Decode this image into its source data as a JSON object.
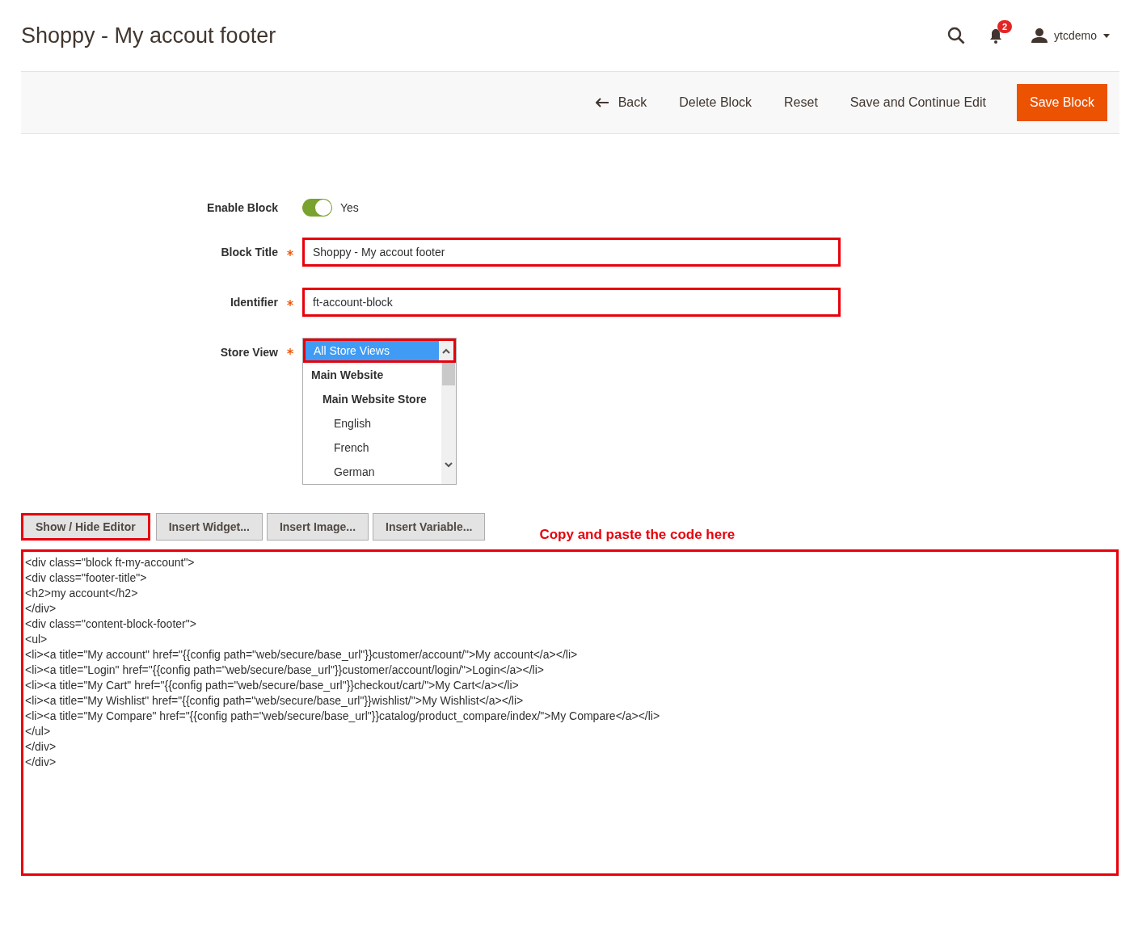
{
  "header": {
    "title": "Shoppy - My accout footer",
    "notifications": "2",
    "user": "ytcdemo"
  },
  "actions": [
    {
      "kind": "back",
      "label": "Back"
    },
    {
      "kind": "plain",
      "label": "Delete Block"
    },
    {
      "kind": "plain",
      "label": "Reset"
    },
    {
      "kind": "plain",
      "label": "Save and Continue Edit"
    },
    {
      "kind": "primary",
      "label": "Save Block"
    }
  ],
  "form": {
    "enable": {
      "label": "Enable Block",
      "on": true,
      "value": "Yes"
    },
    "title": {
      "label": "Block Title",
      "required": true,
      "value": "Shoppy - My accout footer",
      "highlighted": true
    },
    "identifier": {
      "label": "Identifier",
      "required": true,
      "value": "ft-account-block",
      "highlighted": true
    },
    "store_view": {
      "label": "Store View",
      "required": true,
      "options": [
        {
          "label": "All Store Views",
          "selected": true,
          "highlighted": true
        },
        {
          "label": "Main Website",
          "selected": false,
          "children": [
            {
              "label": "Main Website Store",
              "selected": false,
              "children": [
                {
                  "label": "English",
                  "selected": false
                },
                {
                  "label": "French",
                  "selected": false
                },
                {
                  "label": "German",
                  "selected": false
                }
              ]
            }
          ]
        }
      ]
    }
  },
  "editor_buttons": [
    {
      "label": "Show / Hide Editor",
      "highlighted": true
    },
    {
      "label": "Insert Widget...",
      "highlighted": false
    },
    {
      "label": "Insert Image...",
      "highlighted": false
    },
    {
      "label": "Insert Variable...",
      "highlighted": false
    }
  ],
  "annotation": "Copy and paste the code here",
  "content": {
    "highlighted": true,
    "value": "<div class=\"block ft-my-account\">\n<div class=\"footer-title\">\n<h2>my account</h2>\n</div>\n<div class=\"content-block-footer\">\n<ul>\n<li><a title=\"My account\" href=\"{{config path=\"web/secure/base_url\"}}customer/account/\">My account</a></li>\n<li><a title=\"Login\" href=\"{{config path=\"web/secure/base_url\"}}customer/account/login/\">Login</a></li>\n<li><a title=\"My Cart\" href=\"{{config path=\"web/secure/base_url\"}}checkout/cart/\">My Cart</a></li>\n<li><a title=\"My Wishlist\" href=\"{{config path=\"web/secure/base_url\"}}wishlist/\">My Wishlist</a></li>\n<li><a title=\"My Compare\" href=\"{{config path=\"web/secure/base_url\"}}catalog/product_compare/index/\">My Compare</a></li>\n</ul>\n</div>\n</div>"
  }
}
